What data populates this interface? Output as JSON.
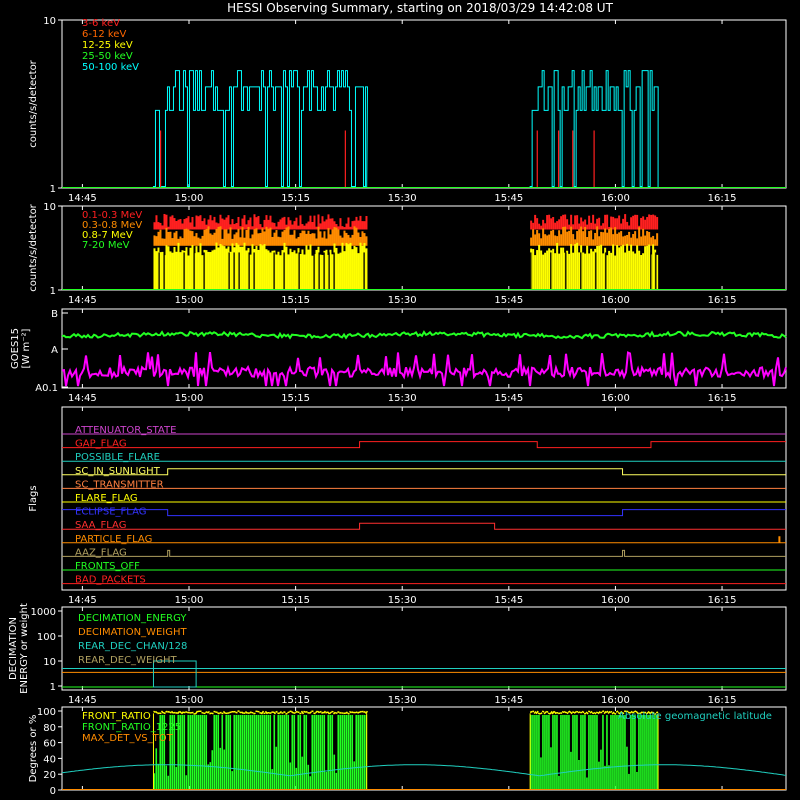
{
  "title": "HESSI Observing Summary, starting on 2018/03/29 14:42:08 UT",
  "time_ticks": [
    "14:45",
    "15:00",
    "15:15",
    "15:30",
    "15:45",
    "16:00",
    "16:15"
  ],
  "colors": {
    "bg": "#000000",
    "axis": "#ffffff",
    "red": "#ff2020",
    "orange": "#ff8c00",
    "yellow": "#ffff00",
    "green": "#22ff22",
    "cyan": "#00ffff",
    "magenta": "#ff00ff",
    "blue": "#3333ff",
    "darkred": "#e02020",
    "olive": "#b0a060",
    "teal": "#20d0c0"
  },
  "chart_data": [
    {
      "id": "lc-low",
      "type": "line",
      "ylabel": "counts/s/detector",
      "yscale": "log",
      "ylim": [
        1,
        10
      ],
      "ytick_labels": [
        "1",
        "10"
      ],
      "legend": [
        "3-6 keV",
        "6-12 keV",
        "12-25 keV",
        "25-50 keV",
        "50-100 keV"
      ],
      "legend_colors": [
        "#ff2020",
        "#ff6600",
        "#ffff00",
        "#22ff22",
        "#00ffff"
      ],
      "observation_intervals": [
        [
          "14:55",
          "15:25"
        ],
        [
          "15:48",
          "16:06"
        ]
      ],
      "series": [
        {
          "name": "50-100 keV",
          "level": 4,
          "peak": 5,
          "color": "#00ffff"
        },
        {
          "name": "3-6 keV",
          "spikes": [
            "14:56",
            "15:22",
            "15:49",
            "15:52",
            "15:54",
            "15:57"
          ],
          "color": "#ff2020"
        }
      ]
    },
    {
      "id": "lc-high",
      "type": "line",
      "ylabel": "counts/s/detector",
      "yscale": "log",
      "ylim": [
        1,
        10
      ],
      "ytick_labels": [
        "1",
        "10"
      ],
      "legend": [
        "0.1-0.3 MeV",
        "0.3-0.8 MeV",
        "0.8-7 MeV",
        "7-20 MeV"
      ],
      "legend_colors": [
        "#ff2020",
        "#ff8c00",
        "#ffff00",
        "#22ff22"
      ],
      "series": [
        {
          "name": "0.1-0.3 MeV",
          "level": 7,
          "color": "#ff2020"
        },
        {
          "name": "0.3-0.8 MeV",
          "level": 5,
          "color": "#ff8c00"
        },
        {
          "name": "0.8-7 MeV",
          "level": 3.2,
          "color": "#ffff00"
        }
      ]
    },
    {
      "id": "goes",
      "type": "line",
      "ylabel": "GOES15 [W m^-2]",
      "ytick_labels": [
        "B",
        "A",
        "A0.1"
      ],
      "series": [
        {
          "name": "long",
          "level": "upper",
          "color": "#22ff22"
        },
        {
          "name": "short",
          "level": "lower",
          "color": "#ff00ff"
        }
      ]
    },
    {
      "id": "flags",
      "type": "line",
      "ylabel": "Flags",
      "flags": [
        {
          "name": "ATTENUATOR_STATE",
          "color": "#cc44cc",
          "toggles": []
        },
        {
          "name": "GAP_FLAG",
          "color": "#ff2020",
          "toggles": [
            "15:24",
            "15:49",
            "16:05"
          ]
        },
        {
          "name": "POSSIBLE_FLARE",
          "color": "#20d0c0",
          "toggles": []
        },
        {
          "name": "SC_IN_SUNLIGHT",
          "color": "#ffff60",
          "toggles": [
            "14:57",
            "16:01"
          ]
        },
        {
          "name": "SC_TRANSMITTER",
          "color": "#ff8040",
          "toggles": []
        },
        {
          "name": "FLARE_FLAG",
          "color": "#ffff00",
          "toggles": []
        },
        {
          "name": "ECLIPSE_FLAG",
          "color": "#3333ff",
          "toggles": [
            "14:57",
            "16:01"
          ]
        },
        {
          "name": "SAA_FLAG",
          "color": "#ff3030",
          "toggles": [
            "15:24",
            "15:43"
          ]
        },
        {
          "name": "PARTICLE_FLAG",
          "color": "#ff8c00",
          "toggles": [
            "16:23"
          ]
        },
        {
          "name": "AAZ_FLAG",
          "color": "#b0a060",
          "toggles": [
            "14:57",
            "16:01"
          ]
        },
        {
          "name": "FRONTS_OFF",
          "color": "#22ff22",
          "toggles": []
        },
        {
          "name": "BAD_PACKETS",
          "color": "#ff2020",
          "toggles": []
        }
      ]
    },
    {
      "id": "decimation",
      "type": "line",
      "ylabel": "DECIMATION ENERGY or weight",
      "yscale": "log",
      "ytick_labels": [
        "1",
        "10",
        "100",
        "1000"
      ],
      "legend": [
        "DECIMATION_ENERGY",
        "DECIMATION_WEIGHT",
        "REAR_DEC_CHAN/128",
        "REAR_DEC_WEIGHT"
      ],
      "legend_colors": [
        "#22ff22",
        "#ff8c00",
        "#20d0c0",
        "#b0a060"
      ]
    },
    {
      "id": "ratios",
      "type": "line",
      "ylabel": "Degrees or %",
      "ylim": [
        0,
        100
      ],
      "ytick_labels": [
        "0",
        "20",
        "40",
        "60",
        "80",
        "100"
      ],
      "legend": [
        "FRONT_RATIO",
        "FRONT_RATIO_1225",
        "MAX_DET_VS_TOT"
      ],
      "legend_colors": [
        "#ffff00",
        "#22ff22",
        "#ff8c00"
      ],
      "annotation": "Absolute geomagnetic latitude",
      "annotation_color": "#20d0c0"
    }
  ]
}
